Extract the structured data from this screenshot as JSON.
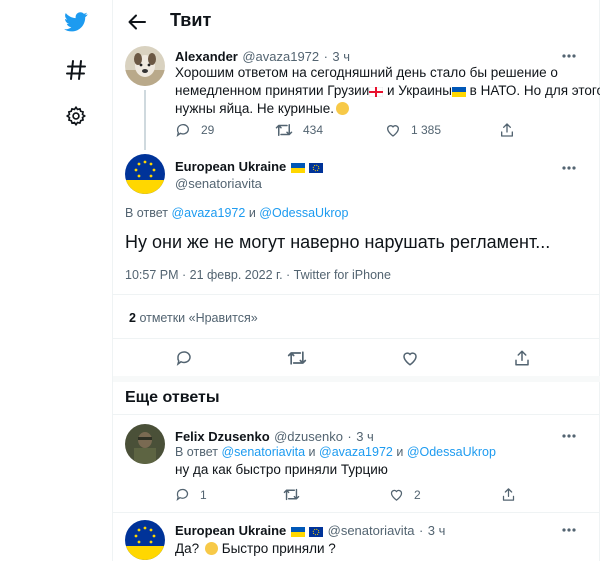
{
  "header": {
    "title": "Твит"
  },
  "parent_tweet": {
    "name": "Alexander",
    "handle": "@avaza1972",
    "time": "3 ч",
    "text_1": "Хорошим ответом на сегодняшний день стало бы решение о",
    "text_2a": "немедленном принятии Грузии",
    "text_2b": "и Украины",
    "text_2c": "в НАТО. Но для этого",
    "text_3": "нужны яйца. Не куриные.",
    "replies": "29",
    "retweets": "434",
    "likes": "1 385"
  },
  "main_tweet": {
    "name": "European Ukraine",
    "handle": "@senatoriavita",
    "reply_prefix": "В ответ",
    "reply_to_1": "@avaza1972",
    "reply_and": "и",
    "reply_to_2": "@OdessaUkrop",
    "text": "Ну они же не могут наверно нарушать регламент...",
    "timestamp": "10:57 PM · 21 февр. 2022 г. · Twitter for iPhone",
    "likes_count": "2",
    "likes_label": "отметки «Нравится»"
  },
  "more_replies": {
    "title": "Еще ответы"
  },
  "reply_1": {
    "name": "Felix Dzusenko",
    "handle": "@dzusenko",
    "time": "3 ч",
    "reply_prefix": "В ответ",
    "reply_to_1": "@senatoriavita",
    "reply_and": "и",
    "reply_to_2": "@avaza1972",
    "reply_and_2": "и",
    "reply_to_3": "@OdessaUkrop",
    "text": "ну да как быстро приняли Турцию",
    "replies": "1",
    "likes": "2"
  },
  "reply_2": {
    "name": "European Ukraine",
    "handle": "@senatoriavita",
    "time": "3 ч",
    "text_a": "Да?",
    "text_b": "Быстро приняли ?"
  },
  "colors": {
    "accent": "#1d9bf0",
    "muted": "#536471",
    "text": "#0f1419"
  },
  "icons": [
    "twitter-bird-icon",
    "hashtag-icon",
    "gear-icon",
    "back-arrow-icon",
    "more-icon",
    "reply-icon",
    "retweet-icon",
    "like-icon",
    "share-icon"
  ]
}
